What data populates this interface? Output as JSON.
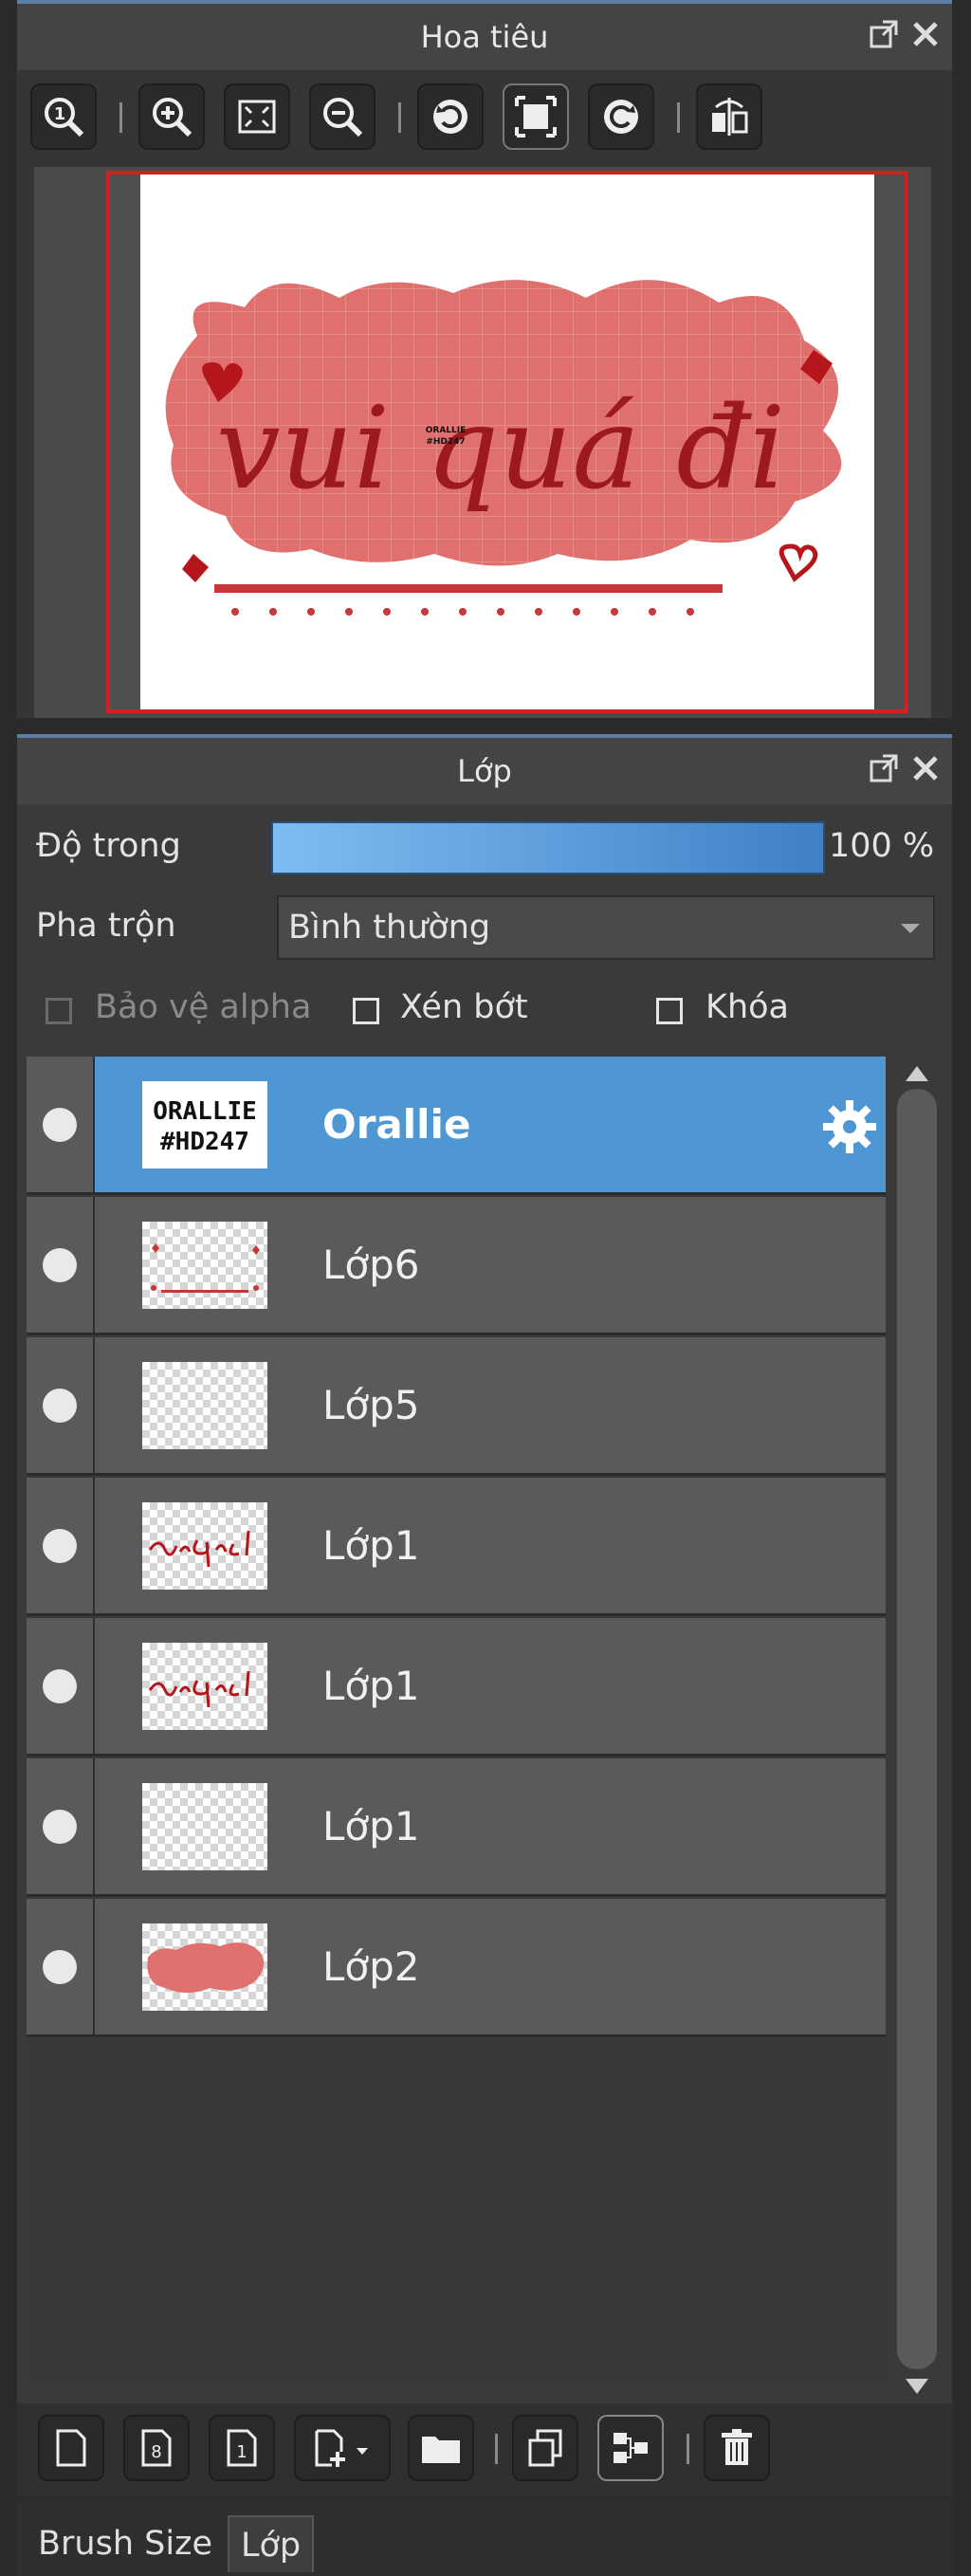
{
  "navigator": {
    "title": "Hoa tiêu",
    "toolbar_icons": [
      "zoom-actual-icon",
      "zoom-in-icon",
      "fit-screen-icon",
      "zoom-out-icon",
      "rotate-left-icon",
      "reset-view-icon",
      "rotate-right-icon",
      "flip-horizontal-icon"
    ],
    "canvas_text": "vui quá đi",
    "canvas_tag_line1": "ORALLIE",
    "canvas_tag_line2": "#HD247"
  },
  "layers": {
    "title": "Lớp",
    "opacity_label": "Độ trong",
    "opacity_value": "100 %",
    "opacity": 1.0,
    "blend_label": "Pha trộn",
    "blend_value": "Bình thường",
    "protect_alpha": "Bảo vệ alpha",
    "clipping": "Xén bớt",
    "lock": "Khóa",
    "items": [
      {
        "name": "Orallie",
        "selected": true,
        "thumb": "orallie",
        "thumb_line1": "ORALLIE",
        "thumb_line2": "#HD247"
      },
      {
        "name": "Lớp6",
        "selected": false,
        "thumb": "decor"
      },
      {
        "name": "Lớp5",
        "selected": false,
        "thumb": "empty"
      },
      {
        "name": "Lớp1",
        "selected": false,
        "thumb": "text"
      },
      {
        "name": "Lớp1",
        "selected": false,
        "thumb": "text"
      },
      {
        "name": "Lớp1",
        "selected": false,
        "thumb": "empty"
      },
      {
        "name": "Lớp2",
        "selected": false,
        "thumb": "blob"
      }
    ],
    "bottom_icons": [
      "new-layer-icon",
      "new-8bit-layer-icon",
      "new-1bit-layer-icon",
      "add-layer-menu-icon",
      "new-folder-icon",
      "duplicate-layer-icon",
      "merge-down-icon",
      "delete-layer-icon"
    ]
  },
  "tabs": [
    "Brush Size",
    "Lớp"
  ],
  "colors": {
    "accent": "#4f97d3",
    "frame": "#d21f24",
    "blob": "#e0706e",
    "ink": "#9c1a1d"
  }
}
